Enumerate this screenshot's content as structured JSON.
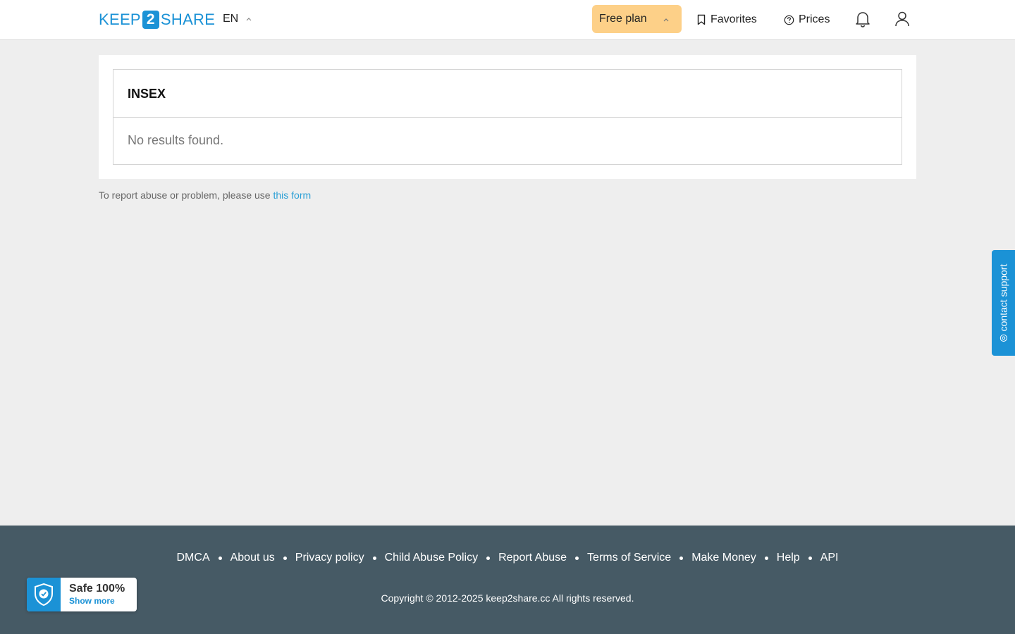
{
  "brand": {
    "logo_part1": "KEEP",
    "logo_part2": "2",
    "logo_part3": "SHARE",
    "accent_color": "#1b92d6"
  },
  "header": {
    "language": "EN",
    "plan_label": "Free plan",
    "plan_color": "#fdd088",
    "favorites_label": "Favorites",
    "prices_label": "Prices",
    "icons": [
      "chevron-up-icon",
      "bookmark-icon",
      "help-circle-icon",
      "bell-icon",
      "user-icon"
    ]
  },
  "main": {
    "title": "INSEX",
    "empty_message": "No results found.",
    "report_text": "To report abuse or problem, please use",
    "report_link": "this form"
  },
  "support_tab": {
    "label": "contact support",
    "icon": "at-icon"
  },
  "footer": {
    "links": [
      "DMCA",
      "About us",
      "Privacy policy",
      "Child Abuse Policy",
      "Report Abuse",
      "Terms of Service",
      "Make Money",
      "Help",
      "API"
    ],
    "copyright": "Copyright © 2012-2025 keep2share.cc All rights reserved.",
    "background": "#465a65"
  },
  "safe_badge": {
    "title": "Safe 100%",
    "subtitle": "Show more",
    "icon": "shield-check-icon"
  }
}
